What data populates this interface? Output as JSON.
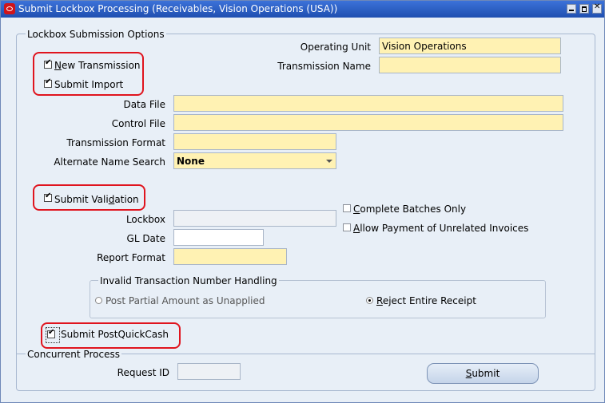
{
  "window": {
    "title": "Submit Lockbox Processing (Receivables, Vision Operations (USA))"
  },
  "sections": {
    "options_title": "Lockbox Submission Options",
    "invalid_title": "Invalid Transaction Number Handling",
    "concurrent_title": "Concurrent Process"
  },
  "fields": {
    "operating_unit_label": "Operating Unit",
    "operating_unit_value": "Vision Operations",
    "transmission_name_label": "Transmission Name",
    "transmission_name_value": "",
    "data_file_label": "Data File",
    "data_file_value": "",
    "control_file_label": "Control File",
    "control_file_value": "",
    "transmission_format_label": "Transmission Format",
    "transmission_format_value": "",
    "alternate_name_search_label": "Alternate Name Search",
    "alternate_name_search_value": "None",
    "lockbox_label": "Lockbox",
    "lockbox_value": "",
    "gl_date_label": "GL Date",
    "gl_date_value": "",
    "report_format_label": "Report Format",
    "report_format_value": "",
    "request_id_label": "Request ID",
    "request_id_value": ""
  },
  "checkboxes": {
    "new_transmission": {
      "first": "N",
      "rest": "ew Transmission",
      "checked": true
    },
    "submit_import": {
      "label": "Submit Import",
      "checked": true
    },
    "submit_validation": {
      "before": "Submit Vali",
      "under": "d",
      "after": "ation",
      "checked": true
    },
    "complete_batches": {
      "first": "C",
      "rest": "omplete Batches Only",
      "checked": false
    },
    "allow_payment": {
      "first": "A",
      "rest": "llow Payment of Unrelated Invoices",
      "checked": false
    },
    "submit_postquickcash": {
      "label": "Submit PostQuickCash",
      "checked": true
    }
  },
  "radios": {
    "post_partial": {
      "label": "Post Partial Amount as Unapplied",
      "selected": false
    },
    "reject_entire": {
      "first": "R",
      "rest": "eject Entire Receipt",
      "selected": true
    }
  },
  "buttons": {
    "submit_first": "S",
    "submit_rest": "ubmit"
  },
  "colors": {
    "titlebar": "#255ec7",
    "required_field": "#fff2b3",
    "highlight": "#e0141e",
    "window_bg": "#e8eff7"
  }
}
